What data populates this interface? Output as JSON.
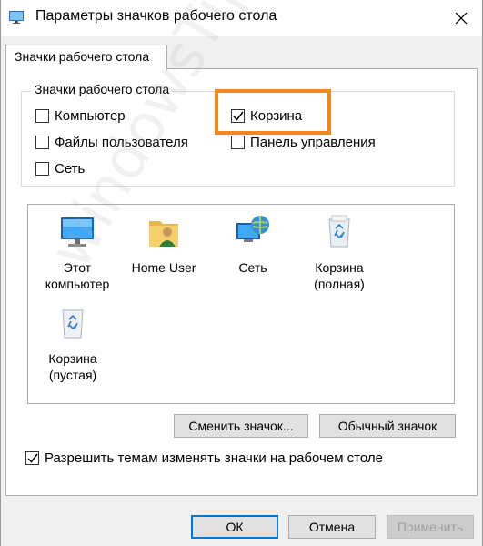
{
  "window": {
    "title": "Параметры значков рабочего стола"
  },
  "tab": {
    "label": "Значки рабочего стола"
  },
  "group": {
    "title": "Значки рабочего стола",
    "checkboxes": [
      {
        "label": "Компьютер",
        "checked": false
      },
      {
        "label": "Корзина",
        "checked": true
      },
      {
        "label": "Файлы пользователя",
        "checked": false
      },
      {
        "label": "Панель управления",
        "checked": false
      },
      {
        "label": "Сеть",
        "checked": false
      }
    ]
  },
  "icons": [
    {
      "label1": "Этот",
      "label2": "компьютер",
      "icon": "computer-icon"
    },
    {
      "label1": "Home User",
      "label2": "",
      "icon": "user-folder-icon"
    },
    {
      "label1": "Сеть",
      "label2": "",
      "icon": "network-icon"
    },
    {
      "label1": "Корзина",
      "label2": "(полная)",
      "icon": "recycle-bin-full-icon"
    },
    {
      "label1": "Корзина",
      "label2": "(пустая)",
      "icon": "recycle-bin-empty-icon"
    }
  ],
  "buttons": {
    "change_icon": "Сменить значок...",
    "default_icon": "Обычный значок",
    "ok": "ОК",
    "cancel": "Отмена",
    "apply": "Применить"
  },
  "themes_checkbox": {
    "label": "Разрешить темам изменять значки на рабочем столе",
    "checked": true
  },
  "watermark": "windowsTips.ru",
  "colors": {
    "highlight": "#f0891e",
    "primary_border": "#0078d7"
  }
}
